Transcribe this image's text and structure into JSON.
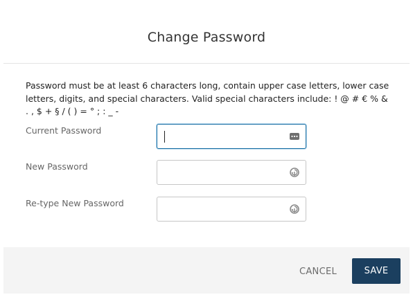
{
  "dialog": {
    "title": "Change Password",
    "info": "Password must be at least 6 characters long, contain upper case letters, lower case letters, digits, and special characters. Valid special characters include: ! @ # € % & . , $ + § / ( ) = ° ; : _ -"
  },
  "fields": {
    "current": {
      "label": "Current Password",
      "value": "",
      "icon": "password-manager-icon"
    },
    "new": {
      "label": "New Password",
      "value": "",
      "icon": "password-generator-icon"
    },
    "retype": {
      "label": "Re-type New Password",
      "value": "",
      "icon": "password-generator-icon"
    }
  },
  "footer": {
    "cancel_label": "CANCEL",
    "save_label": "SAVE"
  },
  "colors": {
    "primary": "#1b3f5f",
    "focus": "#1a6fa3"
  }
}
